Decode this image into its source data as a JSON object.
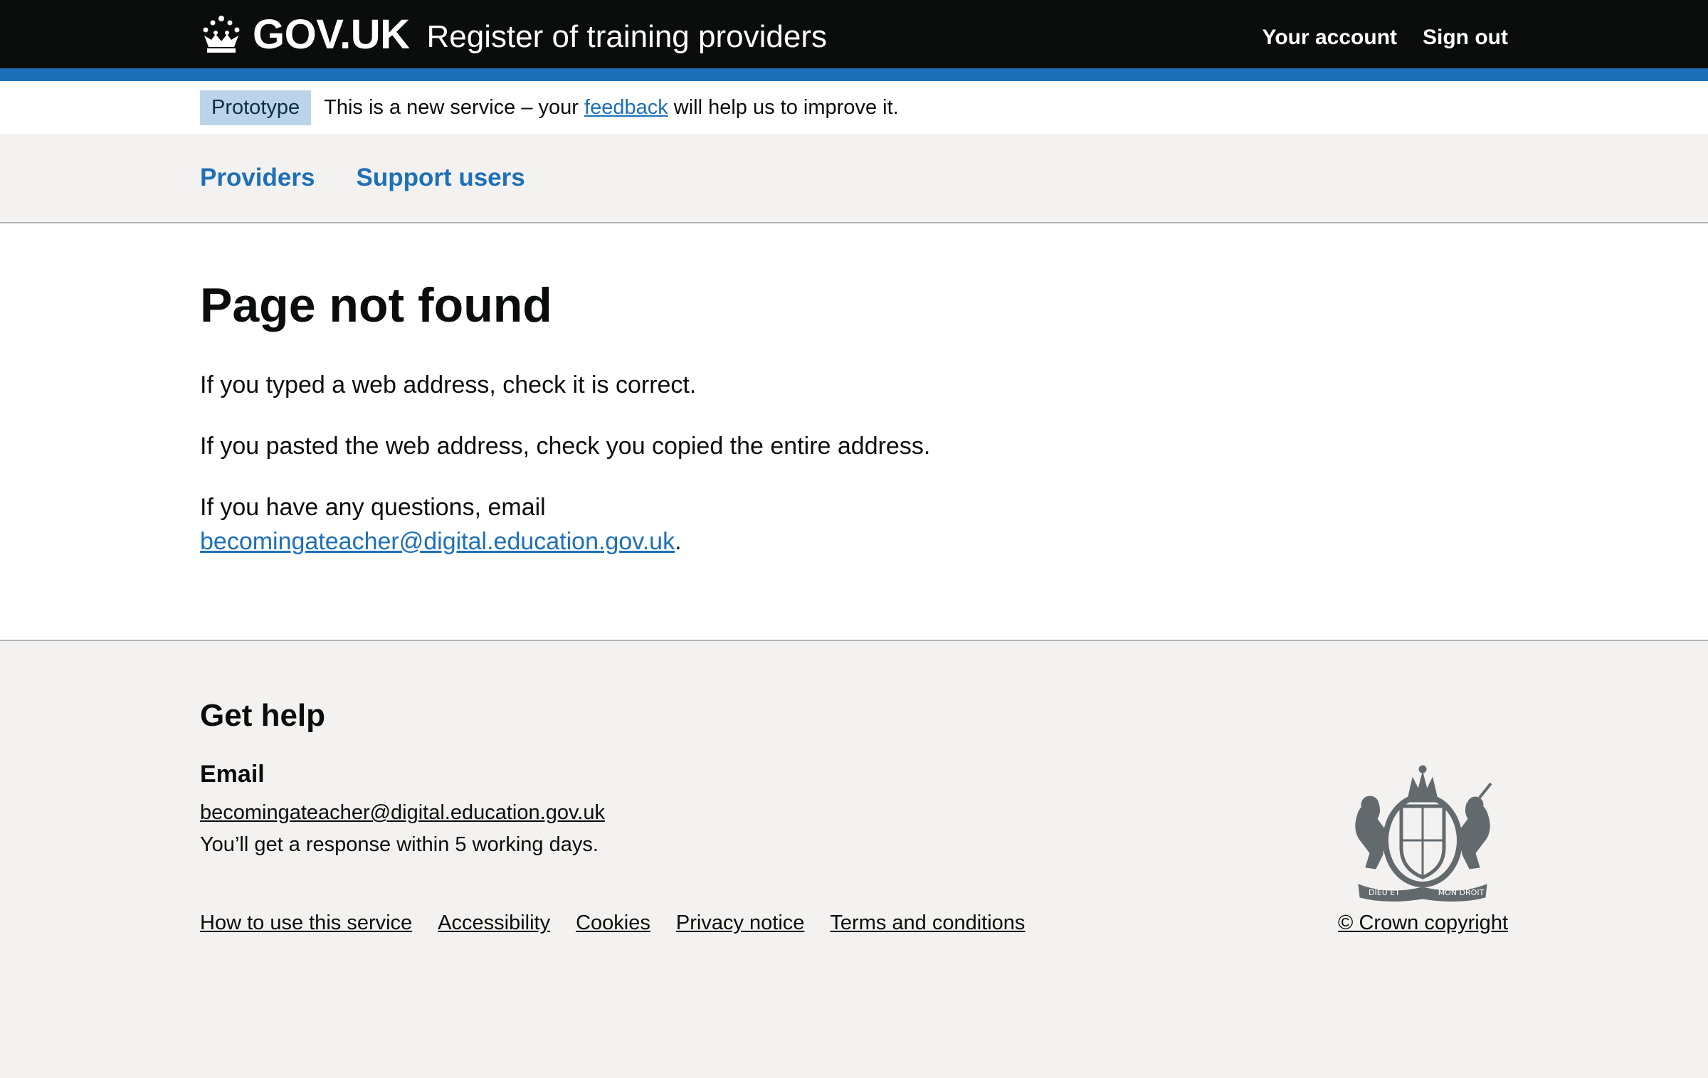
{
  "header": {
    "logo_text": "GOV.UK",
    "service_name": "Register of training providers",
    "nav": [
      {
        "label": "Your account"
      },
      {
        "label": "Sign out"
      }
    ]
  },
  "phase_banner": {
    "tag": "Prototype",
    "text_before": "This is a new service – your",
    "link": "feedback",
    "text_after": "will help us to improve it."
  },
  "primary_nav": {
    "items": [
      {
        "label": "Providers"
      },
      {
        "label": "Support users"
      }
    ]
  },
  "main": {
    "title": "Page not found",
    "paragraph_1": "If you typed a web address, check it is correct.",
    "paragraph_2": "If you pasted the web address, check you copied the entire address.",
    "paragraph_3_text": "If you have any questions, email",
    "paragraph_3_link": "becomingateacher@digital.education.gov.uk",
    "paragraph_3_end": "."
  },
  "footer": {
    "heading": "Get help",
    "email_heading": "Email",
    "email_link": "becomingateacher@digital.education.gov.uk",
    "response_time": "You’ll get a response within 5 working days.",
    "links": [
      {
        "label": "How to use this service"
      },
      {
        "label": "Accessibility"
      },
      {
        "label": "Cookies"
      },
      {
        "label": "Privacy notice"
      },
      {
        "label": "Terms and conditions"
      }
    ],
    "copyright": "© Crown copyright",
    "crest_icon": "royal-coat-of-arms-icon",
    "crest_motto_left": "DIEU ET",
    "crest_motto_right": "MON DROIT"
  },
  "colors": {
    "header_bg": "#0b0c0c",
    "brand_blue": "#1d70b8",
    "tag_bg": "#bbd4ea",
    "footer_bg": "#f3f2f1"
  }
}
